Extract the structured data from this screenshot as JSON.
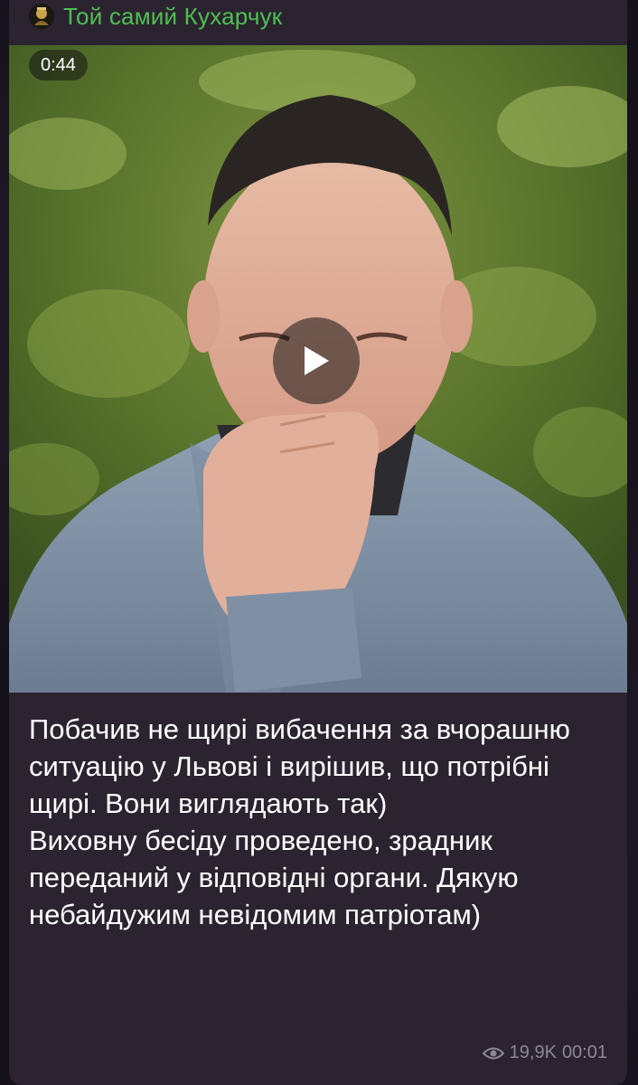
{
  "message": {
    "sender": "Той самий Кухарчук",
    "video": {
      "duration": "0:44"
    },
    "caption": {
      "paragraph_1": "Побачив не щирі вибачення за вчорашню ситуацію у Львові і вирішив, що потрібні щирі. Вони виглядають так)",
      "paragraph_2": "Виховну бесіду проведено, зрадник переданий у відповідні органи. Дякую небайдужим невідомим патріотам)"
    },
    "views": "19,9K",
    "time": "00:01"
  },
  "icons": {
    "avatar": "channel-avatar",
    "play": "play-icon",
    "views": "eye-icon"
  },
  "colors": {
    "sender_name": "#4fbf52",
    "bubble": "#2b2430",
    "meta": "#8d8794"
  }
}
